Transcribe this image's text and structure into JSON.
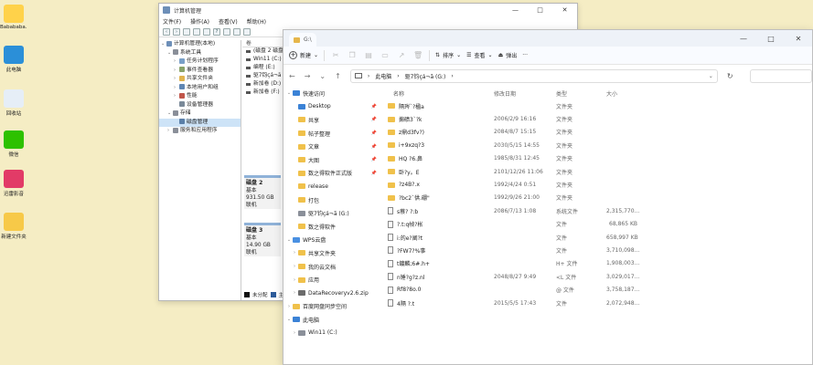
{
  "desktop": {
    "icons": [
      {
        "label": "Babababa...",
        "color": "#ffd24a"
      },
      {
        "label": "此电脑",
        "color": "#2b8fd8"
      },
      {
        "label": "回收站",
        "color": "#e6eef7"
      },
      {
        "label": "微信",
        "color": "#2dc100"
      },
      {
        "label": "迅雷影音",
        "color": "#e23b67"
      },
      {
        "label": "新建文件夹",
        "color": "#f7c948"
      }
    ]
  },
  "cm": {
    "title": "计算机管理",
    "menus": [
      "文件(F)",
      "操作(A)",
      "查看(V)",
      "帮助(H)"
    ],
    "tree": [
      {
        "label": "计算机管理(本地)",
        "indent": 0,
        "arrow": "⌄",
        "color": "#6d8fb8"
      },
      {
        "label": "系统工具",
        "indent": 1,
        "arrow": "⌄",
        "color": "#8a8f99"
      },
      {
        "label": "任务计划程序",
        "indent": 2,
        "arrow": "›",
        "color": "#7aa0c8"
      },
      {
        "label": "事件查看器",
        "indent": 2,
        "arrow": "›",
        "color": "#8aa36a"
      },
      {
        "label": "共享文件夹",
        "indent": 2,
        "arrow": "›",
        "color": "#e1b44e"
      },
      {
        "label": "本地用户和组",
        "indent": 2,
        "arrow": "›",
        "color": "#5f86b3"
      },
      {
        "label": "性能",
        "indent": 2,
        "arrow": "›",
        "color": "#c0564a"
      },
      {
        "label": "设备管理器",
        "indent": 2,
        "arrow": "",
        "color": "#7b8a99"
      },
      {
        "label": "存储",
        "indent": 1,
        "arrow": "⌄",
        "color": "#8a8f99"
      },
      {
        "label": "磁盘管理",
        "indent": 2,
        "arrow": "",
        "color": "#5a7fa8",
        "selected": true
      },
      {
        "label": "服务和应用程序",
        "indent": 1,
        "arrow": "›",
        "color": "#8a8f99"
      }
    ],
    "col_header": "卷",
    "volumes": [
      "(磁盘 2 磁盘分区 1)",
      "Win11 (C:)",
      "编程 (E:)",
      "驱7钧çá¬ã (G:)",
      "新加卷 (D:)",
      "新加卷 (F:)"
    ],
    "disks": [
      {
        "name": "磁盘 2",
        "type": "基本",
        "size": "931.50 GB",
        "status": "联机"
      },
      {
        "name": "磁盘 3",
        "type": "基本",
        "size": "14.90 GB",
        "status": "联机"
      }
    ],
    "legend": [
      "未分配",
      "主分区"
    ]
  },
  "ex": {
    "tab_title": "G:\\",
    "cmd": {
      "new": "新建",
      "sort": "排序",
      "view": "查看",
      "eject": "弹出",
      "more": "···"
    },
    "breadcrumb": [
      "此电脑",
      "驱7钧çá¬ã (G:)"
    ],
    "nav": [
      {
        "label": "快速访问",
        "chev": "⌄",
        "kind": "star",
        "indent": 0
      },
      {
        "label": "Desktop",
        "chev": "",
        "kind": "blue",
        "indent": 1,
        "pin": true
      },
      {
        "label": "共享",
        "chev": "",
        "kind": "folder",
        "indent": 1,
        "pin": true
      },
      {
        "label": "帖子整理",
        "chev": "",
        "kind": "folder",
        "indent": 1,
        "pin": true
      },
      {
        "label": "文章",
        "chev": "",
        "kind": "folder",
        "indent": 1,
        "pin": true
      },
      {
        "label": "大图",
        "chev": "",
        "kind": "folder",
        "indent": 1,
        "pin": true
      },
      {
        "label": "数之得软件正式版",
        "chev": "",
        "kind": "folder",
        "indent": 1,
        "pin": true
      },
      {
        "label": "release",
        "chev": "",
        "kind": "folder",
        "indent": 1
      },
      {
        "label": "打包",
        "chev": "",
        "kind": "folder",
        "indent": 1
      },
      {
        "label": "驱7钧çá¬ã (G:)",
        "chev": "",
        "kind": "drive",
        "indent": 1
      },
      {
        "label": "数之得软件",
        "chev": "",
        "kind": "folder",
        "indent": 1
      },
      {
        "label": "WPS云盘",
        "chev": "⌄",
        "kind": "cloud",
        "indent": 0
      },
      {
        "label": "共享文件夹",
        "chev": "›",
        "kind": "folder",
        "indent": 1
      },
      {
        "label": "我的云文档",
        "chev": "›",
        "kind": "folder",
        "indent": 1
      },
      {
        "label": "应用",
        "chev": "›",
        "kind": "folder",
        "indent": 1
      },
      {
        "label": "DataRecoveryv2.6.zip",
        "chev": "›",
        "kind": "zip",
        "indent": 1
      },
      {
        "label": "百度网盘同步空间",
        "chev": "›",
        "kind": "folder",
        "indent": 0
      },
      {
        "label": "此电脑",
        "chev": "⌄",
        "kind": "pc",
        "indent": 0
      },
      {
        "label": "Win11 (C:)",
        "chev": "›",
        "kind": "drive",
        "indent": 1
      }
    ],
    "columns": {
      "name": "名称",
      "date": "修改日期",
      "type": "类型",
      "size": "大小"
    },
    "files": [
      {
        "name": "隔琌`?楹a",
        "date": "",
        "type": "文件夹",
        "size": "",
        "kind": "folder"
      },
      {
        "name": "搧碛3`?k",
        "date": "2006/2/9 16:16",
        "type": "文件夹",
        "size": "",
        "kind": "folder"
      },
      {
        "name": "z鼎d3fv?)",
        "date": "2084/8/7 15:15",
        "type": "文件夹",
        "size": "",
        "kind": "folder"
      },
      {
        "name": "i+9xzq?3",
        "date": "2030/5/15 14:55",
        "type": "文件夹",
        "size": "",
        "kind": "folder"
      },
      {
        "name": "HQ  ?6.鼻",
        "date": "1985/8/31 12:45",
        "type": "文件夹",
        "size": "",
        "kind": "folder"
      },
      {
        "name": "卧?y。E",
        "date": "2101/12/26 11:06",
        "type": "文件夹",
        "size": "",
        "kind": "folder"
      },
      {
        "name": "?z4B?.x",
        "date": "1992/4/24 0:51",
        "type": "文件夹",
        "size": "",
        "kind": "folder"
      },
      {
        "name": "?bc2`供.硼\"",
        "date": "1992/9/26 21:00",
        "type": "文件夹",
        "size": "",
        "kind": "folder"
      },
      {
        "name": "s蔡?  ?:b",
        "date": "2086/7/13 1:08",
        "type": "系统文件",
        "size": "2,315,770...",
        "kind": "file"
      },
      {
        "name": "?.t:q帧?枨",
        "date": "",
        "type": "文件",
        "size": "68,865 KB",
        "kind": "file"
      },
      {
        "name": "i:的e?阐?t",
        "date": "",
        "type": "文件",
        "size": "658,997 KB",
        "kind": "file"
      },
      {
        "name": "?FW7?%事",
        "date": "",
        "type": "文件",
        "size": "3,710,098...",
        "kind": "file"
      },
      {
        "name": "t鍍麟;6#.h+",
        "date": "",
        "type": "H+ 文件",
        "size": "1,908,003...",
        "kind": "file"
      },
      {
        "name": "n锤?g?z.nl",
        "date": "2048/8/27 9:49",
        "type": "<L 文件",
        "size": "3,029,017...",
        "kind": "file"
      },
      {
        "name": "Rf8?8o.0",
        "date": "",
        "type": "@  文件",
        "size": "3,758,187...",
        "kind": "file"
      },
      {
        "name": "4隔   ?.t",
        "date": "2015/5/5 17:43",
        "type": "文件",
        "size": "2,072,948...",
        "kind": "file"
      }
    ]
  }
}
